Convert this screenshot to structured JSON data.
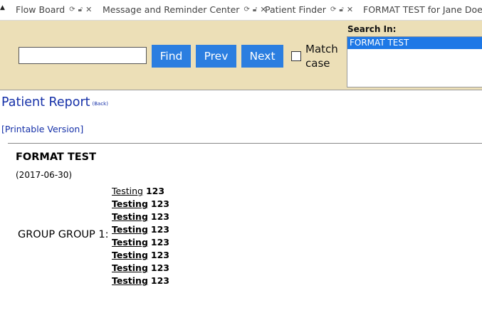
{
  "tabs": [
    {
      "label": "Flow Board"
    },
    {
      "label": "Message and Reminder Center"
    },
    {
      "label": "Patient Finder"
    },
    {
      "label": "FORMAT TEST for Jane Doe on"
    }
  ],
  "search": {
    "placeholder": "",
    "value": "",
    "find_label": "Find",
    "prev_label": "Prev",
    "next_label": "Next",
    "match_case_line1": "Match",
    "match_case_line2": "case",
    "search_in_label": "Search In:",
    "search_in_options": [
      "FORMAT TEST"
    ]
  },
  "report": {
    "title": "Patient Report",
    "back_label": "(Back)",
    "printable_label": "[Printable Version]",
    "form_name": "FORMAT TEST",
    "form_date": "(2017-06-30)",
    "group_label": "GROUP GROUP 1:",
    "rows": [
      {
        "label": "Testing",
        "value": "123"
      },
      {
        "label": "Testing",
        "value": "123"
      },
      {
        "label": "Testing",
        "value": "123"
      },
      {
        "label": "Testing",
        "value": "123"
      },
      {
        "label": "Testing",
        "value": "123"
      },
      {
        "label": "Testing",
        "value": "123"
      },
      {
        "label": "Testing",
        "value": "123"
      },
      {
        "label": "Testing",
        "value": "123"
      }
    ]
  },
  "colors": {
    "toolbar_bg": "#ecdfb7",
    "button_blue": "#2b7ee0",
    "link_blue": "#1530a8",
    "selected_option": "#1e78e6"
  }
}
